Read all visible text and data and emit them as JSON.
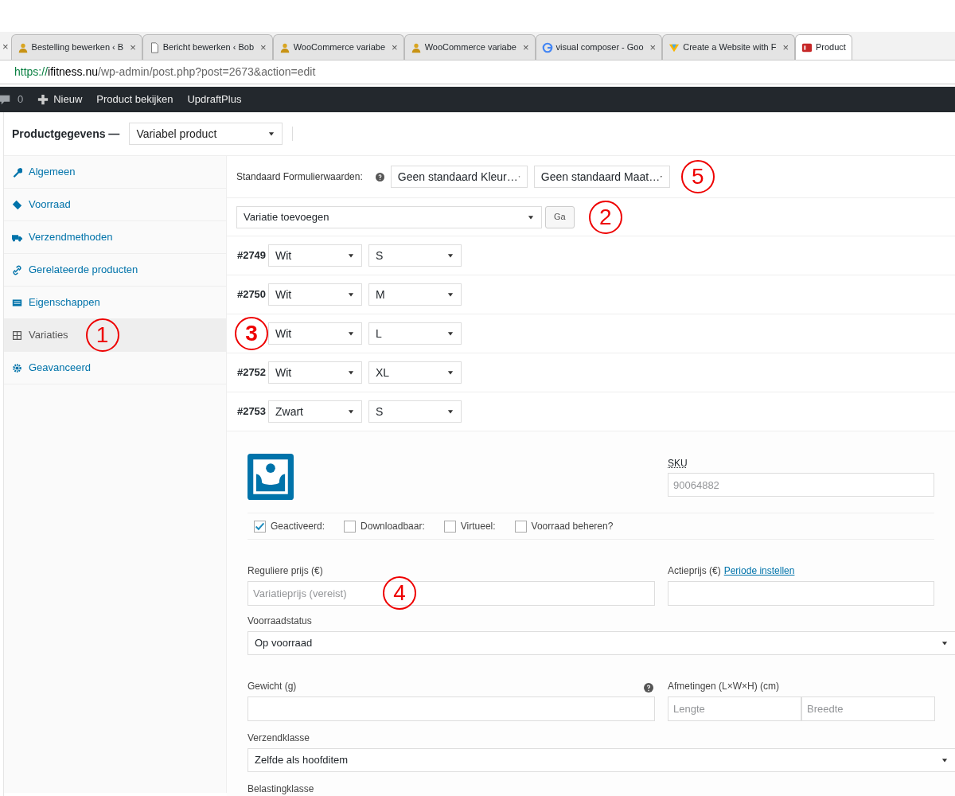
{
  "browser": {
    "tabs": [
      {
        "title": "Bestelling bewerken ‹ B",
        "kind": "person",
        "selected": false
      },
      {
        "title": "Bericht bewerken ‹ Bob",
        "kind": "page",
        "selected": false
      },
      {
        "title": "WooCommerce variabe",
        "kind": "person",
        "selected": false
      },
      {
        "title": "WooCommerce variabe",
        "kind": "person",
        "selected": false
      },
      {
        "title": "visual composer - Goo",
        "kind": "google",
        "selected": false
      },
      {
        "title": "Create a Website with F",
        "kind": "logo",
        "selected": false
      },
      {
        "title": "Product",
        "kind": "brand",
        "selected": true
      }
    ],
    "close_glyph": "×",
    "url": {
      "scheme": "https://",
      "host": "ifitness.nu",
      "path": "/wp-admin/post.php?post=2673&action=edit"
    }
  },
  "admin_bar": {
    "comments": "0",
    "new": "Nieuw",
    "links": [
      "Product bekijken",
      "UpdraftPlus"
    ]
  },
  "product_data": {
    "title": "Productgegevens —",
    "type": "Variabel product",
    "tabs": [
      {
        "label": "Algemeen",
        "kind": "wrench",
        "selected": false
      },
      {
        "label": "Voorraad",
        "kind": "tag",
        "selected": false
      },
      {
        "label": "Verzendmethoden",
        "kind": "truck",
        "selected": false
      },
      {
        "label": "Gerelateerde producten",
        "kind": "link",
        "selected": false
      },
      {
        "label": "Eigenschappen",
        "kind": "list",
        "selected": false
      },
      {
        "label": "Variaties",
        "kind": "grid",
        "selected": true,
        "annotation": "1"
      },
      {
        "label": "Geavanceerd",
        "kind": "gear",
        "selected": false
      }
    ],
    "defaults": {
      "label": "Standaard Formulierwaarden:",
      "selects": [
        "Geen standaard Kleur…",
        "Geen standaard Maat…"
      ],
      "annotation": "5"
    },
    "add_variation": {
      "select": "Variatie toevoegen",
      "button": "Ga",
      "annotation": "2"
    },
    "variations": [
      {
        "id": "#2749",
        "attribute_1": "Wit",
        "attribute_2": "S"
      },
      {
        "id": "#2750",
        "attribute_1": "Wit",
        "attribute_2": "M"
      },
      {
        "annotation": "3",
        "attribute_1": "Wit",
        "attribute_2": "L"
      },
      {
        "id": "#2752",
        "attribute_1": "Wit",
        "attribute_2": "XL"
      },
      {
        "id": "#2753",
        "attribute_1": "Zwart",
        "attribute_2": "S"
      }
    ],
    "detail": {
      "sku_label": "SKU",
      "sku_placeholder": "90064882",
      "options": [
        {
          "label": "Geactiveerd:",
          "checked": true
        },
        {
          "label": "Downloadbaar:",
          "checked": false
        },
        {
          "label": "Virtueel:",
          "checked": false
        },
        {
          "label": "Voorraad beheren?",
          "checked": false
        }
      ],
      "regular_price_label": "Reguliere prijs (€)",
      "regular_price_placeholder": "Variatieprijs (vereist)",
      "regular_price_annotation": "4",
      "sale_price_label": "Actieprijs (€)",
      "sale_period_link": "Periode instellen",
      "stock_status_label": "Voorraadstatus",
      "stock_status": "Op voorraad",
      "weight_label": "Gewicht (g)",
      "dimensions_label": "Afmetingen (L×W×H) (cm)",
      "dimension_placeholders": [
        "Lengte",
        "Breedte"
      ],
      "shipping_class_label": "Verzendklasse",
      "shipping_class": "Zelfde als hoofditem",
      "tax_class_label": "Belastingklasse"
    }
  }
}
